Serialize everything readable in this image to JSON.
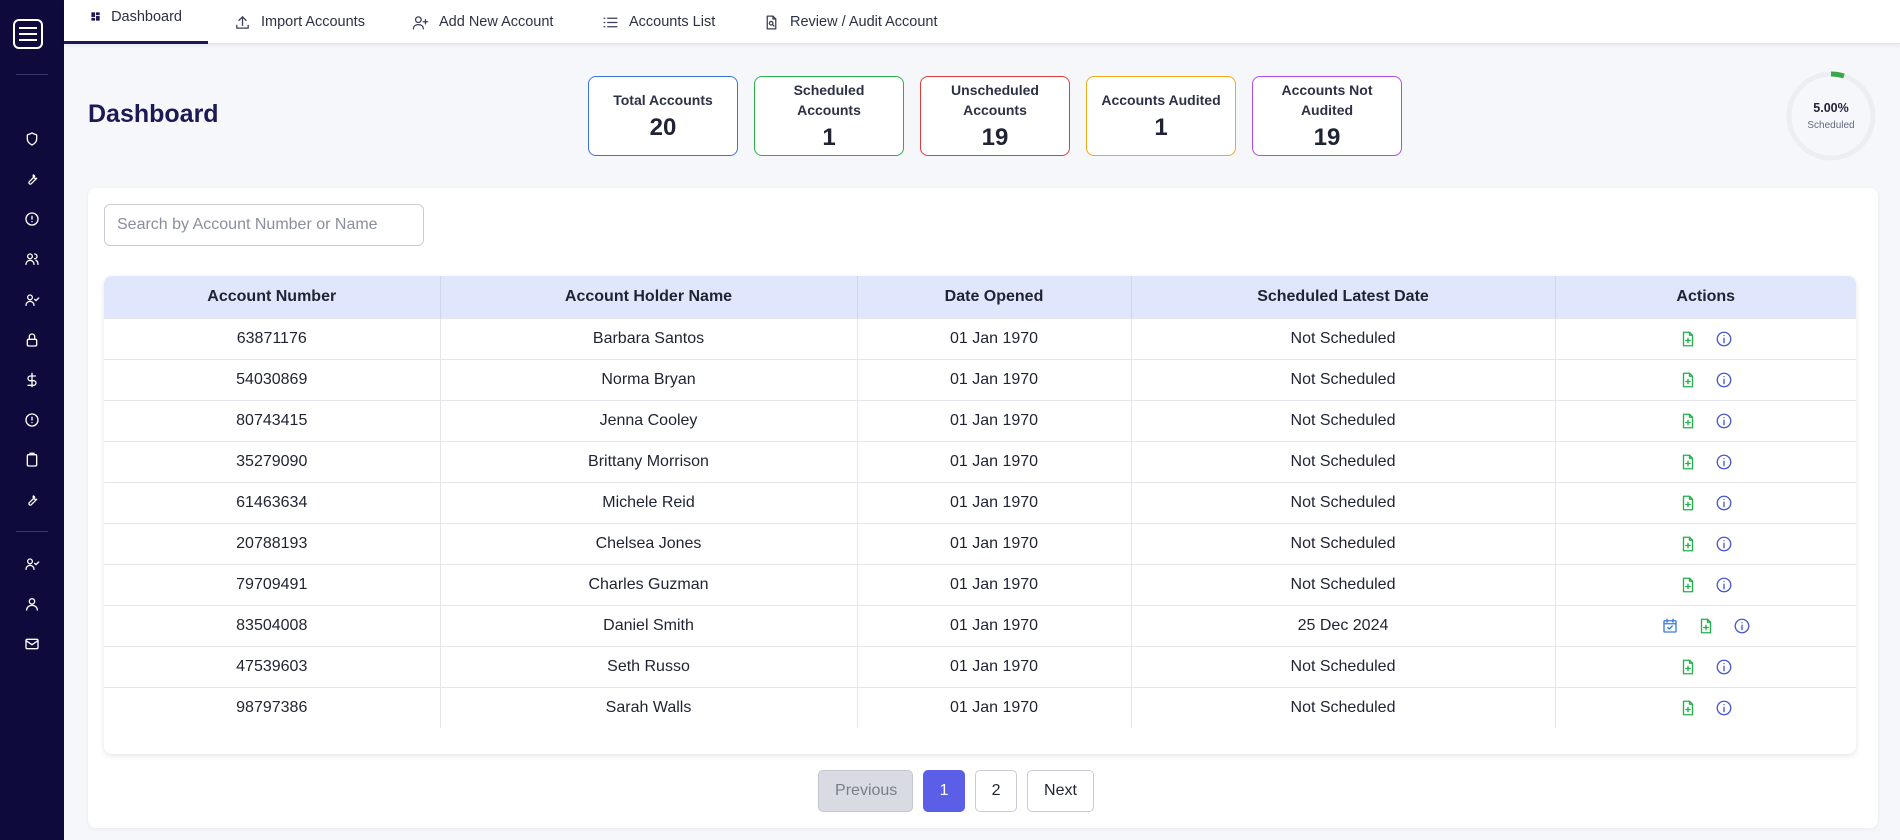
{
  "nav": {
    "tabs": [
      {
        "label": "Dashboard",
        "icon": "dashboard-icon",
        "active": true
      },
      {
        "label": "Import Accounts",
        "icon": "upload-icon"
      },
      {
        "label": "Add New Account",
        "icon": "add-user-icon"
      },
      {
        "label": "Accounts List",
        "icon": "list-icon"
      },
      {
        "label": "Review / Audit Account",
        "icon": "document-search-icon"
      }
    ]
  },
  "sidebar": {
    "icons": [
      "shield-icon",
      "wrench-icon",
      "alert-circle-icon",
      "users-icon",
      "user-check-icon",
      "lock-icon",
      "dollar-icon",
      "alert-circle-icon",
      "clipboard-icon",
      "wrench-icon",
      "user-check-icon",
      "user-icon",
      "mail-icon"
    ]
  },
  "page": {
    "title": "Dashboard"
  },
  "stats": [
    {
      "label_lines": [
        "Total Accounts"
      ],
      "value": "20",
      "color": "#3a74d9"
    },
    {
      "label_lines": [
        "Scheduled",
        "Accounts"
      ],
      "value": "1",
      "color": "#2cae4a"
    },
    {
      "label_lines": [
        "Unscheduled",
        "Accounts"
      ],
      "value": "19",
      "color": "#e23b3b"
    },
    {
      "label_lines": [
        "Accounts Audited"
      ],
      "value": "1",
      "color": "#f0a91b"
    },
    {
      "label_lines": [
        "Accounts Not",
        "Audited"
      ],
      "value": "19",
      "color": "#b04ce0"
    }
  ],
  "progress": {
    "percent_text": "5.00%",
    "label": "Scheduled",
    "fraction": 0.05,
    "color": "#3aa84a"
  },
  "search": {
    "placeholder": "Search by Account Number or Name",
    "value": ""
  },
  "table": {
    "columns": [
      "Account Number",
      "Account Holder Name",
      "Date Opened",
      "Scheduled Latest Date",
      "Actions"
    ],
    "rows": [
      {
        "number": "63871176",
        "name": "Barbara Santos",
        "opened": "01 Jan 1970",
        "scheduled": "Not Scheduled",
        "has_schedule": false
      },
      {
        "number": "54030869",
        "name": "Norma Bryan",
        "opened": "01 Jan 1970",
        "scheduled": "Not Scheduled",
        "has_schedule": false
      },
      {
        "number": "80743415",
        "name": "Jenna Cooley",
        "opened": "01 Jan 1970",
        "scheduled": "Not Scheduled",
        "has_schedule": false
      },
      {
        "number": "35279090",
        "name": "Brittany Morrison",
        "opened": "01 Jan 1970",
        "scheduled": "Not Scheduled",
        "has_schedule": false
      },
      {
        "number": "61463634",
        "name": "Michele Reid",
        "opened": "01 Jan 1970",
        "scheduled": "Not Scheduled",
        "has_schedule": false
      },
      {
        "number": "20788193",
        "name": "Chelsea Jones",
        "opened": "01 Jan 1970",
        "scheduled": "Not Scheduled",
        "has_schedule": false
      },
      {
        "number": "79709491",
        "name": "Charles Guzman",
        "opened": "01 Jan 1970",
        "scheduled": "Not Scheduled",
        "has_schedule": false
      },
      {
        "number": "83504008",
        "name": "Daniel Smith",
        "opened": "01 Jan 1970",
        "scheduled": "25 Dec 2024",
        "has_schedule": true
      },
      {
        "number": "47539603",
        "name": "Seth Russo",
        "opened": "01 Jan 1970",
        "scheduled": "Not Scheduled",
        "has_schedule": false
      },
      {
        "number": "98797386",
        "name": "Sarah Walls",
        "opened": "01 Jan 1970",
        "scheduled": "Not Scheduled",
        "has_schedule": false
      }
    ]
  },
  "pagination": {
    "previous_label": "Previous",
    "pages": [
      "1",
      "2"
    ],
    "current": "1",
    "next_label": "Next"
  }
}
